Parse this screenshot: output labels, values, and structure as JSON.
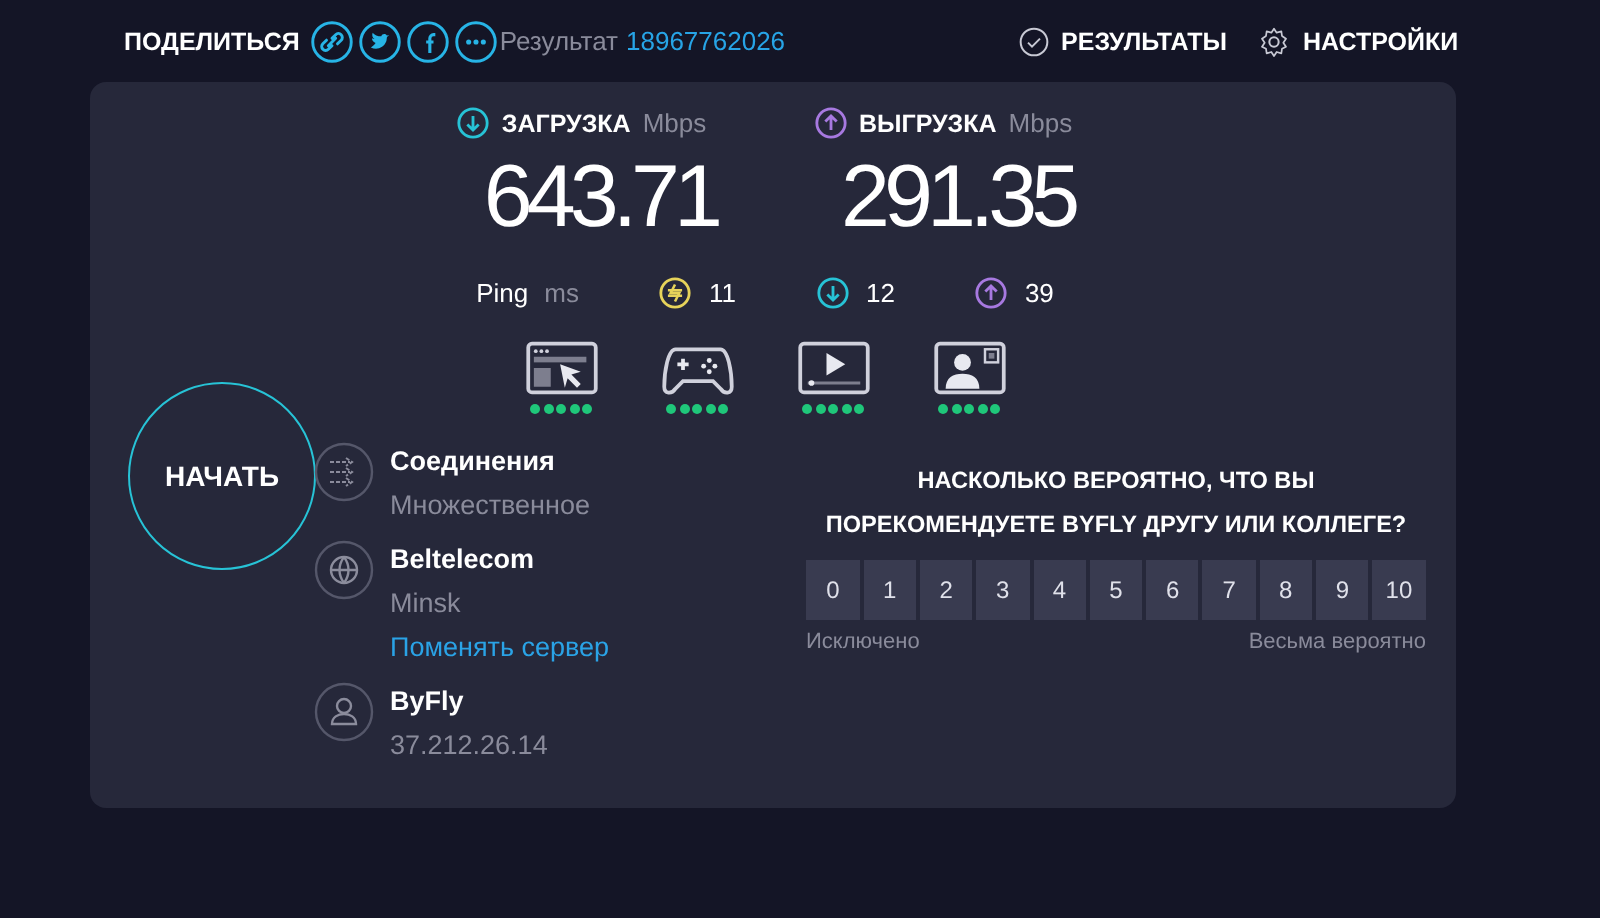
{
  "header": {
    "share_label": "ПОДЕЛИТЬСЯ",
    "share_buttons": [
      {
        "kind": "link"
      },
      {
        "kind": "twitter"
      },
      {
        "kind": "facebook"
      },
      {
        "kind": "more"
      }
    ],
    "result_label": "Результат",
    "result_id": "18967762026",
    "nav": [
      {
        "kind": "results",
        "label": "РЕЗУЛЬТАТЫ"
      },
      {
        "kind": "settings",
        "label": "НАСТРОЙКИ"
      }
    ]
  },
  "speeds": [
    {
      "kind": "download",
      "label": "ЗАГРУЗКА",
      "unit": "Mbps",
      "value": "643.71",
      "color": "#27c3d6"
    },
    {
      "kind": "upload",
      "label": "ВЫГРУЗКА",
      "unit": "Mbps",
      "value": "291.35",
      "color": "#a779e0"
    }
  ],
  "ping": {
    "label": "Ping",
    "unit": "ms",
    "readings": [
      {
        "kind": "idle",
        "value": "11",
        "color": "#e6d35a"
      },
      {
        "kind": "download",
        "value": "12",
        "color": "#27c3d6"
      },
      {
        "kind": "upload",
        "value": "39",
        "color": "#a779e0"
      }
    ]
  },
  "quality": [
    {
      "kind": "browsing",
      "stars": 5
    },
    {
      "kind": "gaming",
      "stars": 5
    },
    {
      "kind": "video",
      "stars": 5
    },
    {
      "kind": "videocall",
      "stars": 5
    }
  ],
  "start_button": "НАЧАТЬ",
  "info": [
    {
      "kind": "connections",
      "title": "Соединения",
      "subtitle": "Множественное"
    },
    {
      "kind": "server",
      "title": "Beltelecom",
      "subtitle": "Minsk",
      "link": "Поменять сервер"
    },
    {
      "kind": "provider",
      "title": "ByFly",
      "subtitle": "37.212.26.14"
    }
  ],
  "survey": {
    "question": "НАСКОЛЬКО ВЕРОЯТНО, ЧТО ВЫ ПОРЕКОМЕНДУЕТЕ BYFLY ДРУГУ ИЛИ КОЛЛЕГЕ?",
    "scale": [
      "0",
      "1",
      "2",
      "3",
      "4",
      "5",
      "6",
      "7",
      "8",
      "9",
      "10"
    ],
    "low_label": "Исключено",
    "high_label": "Весьма вероятно"
  }
}
